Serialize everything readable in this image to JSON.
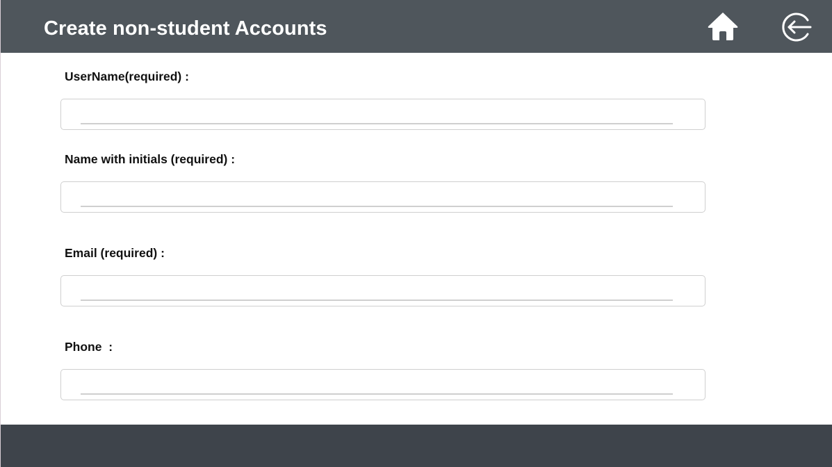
{
  "header": {
    "title": "Create non-student Accounts",
    "home_icon": "home-icon",
    "back_icon": "logout-arrow-circle-icon"
  },
  "form": {
    "fields": [
      {
        "label": "UserName(required) :",
        "value": "",
        "placeholder": ""
      },
      {
        "label": "Name with initials (required) :",
        "value": "",
        "placeholder": ""
      },
      {
        "label": "Email (required) :",
        "value": "",
        "placeholder": ""
      },
      {
        "label": "Phone  :",
        "value": "",
        "placeholder": ""
      }
    ]
  },
  "colors": {
    "header_bg": "#4f565c",
    "footer_bg": "#3e444b",
    "input_border": "#cfcfcf",
    "label_text": "#111111"
  }
}
